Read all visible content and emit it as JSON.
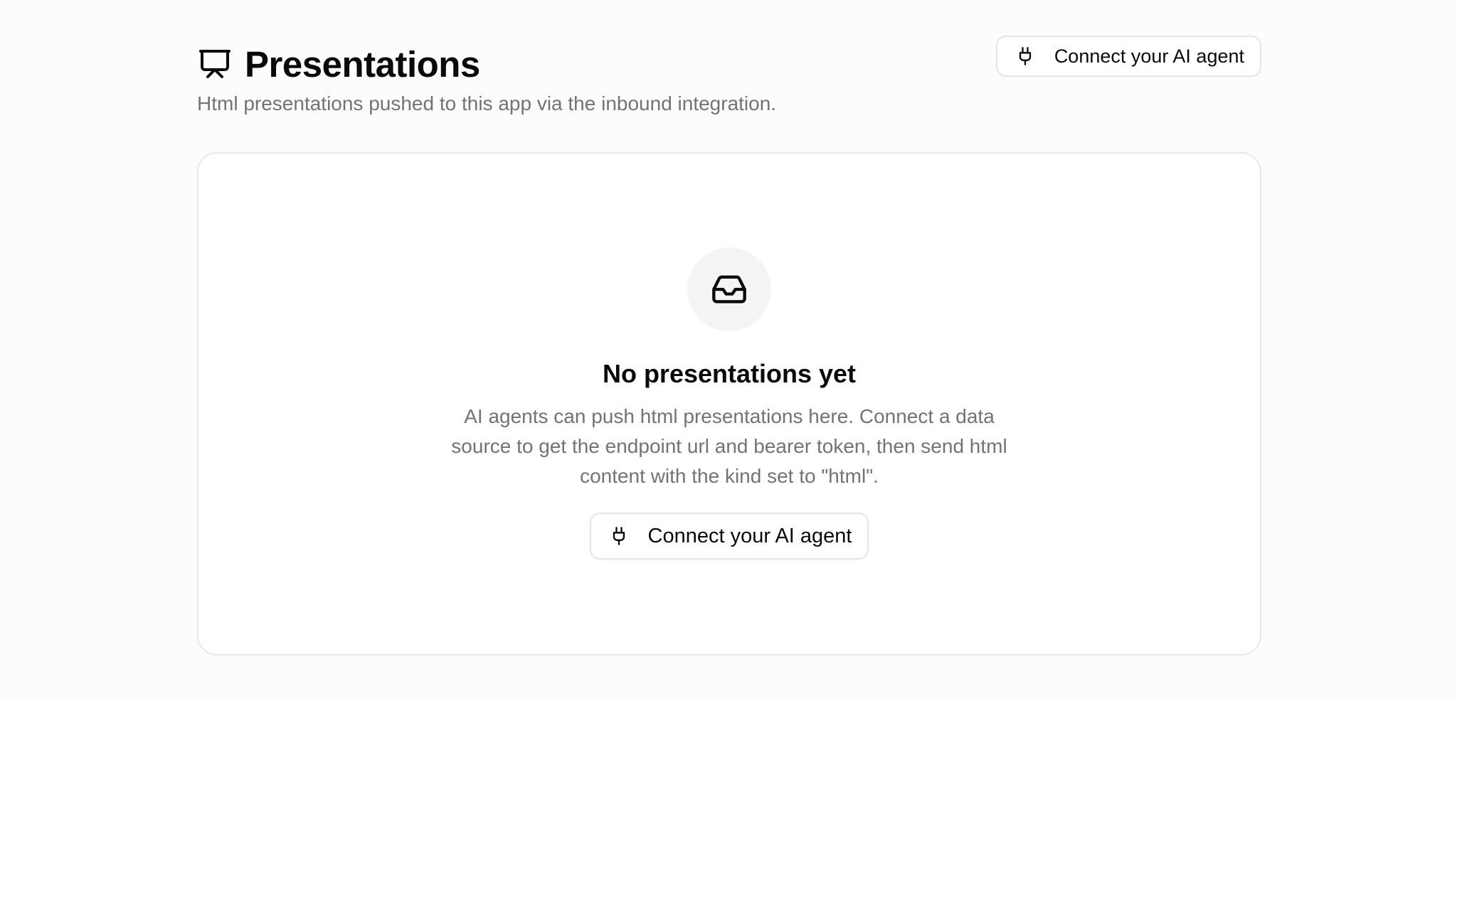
{
  "header": {
    "title": "Presentations",
    "subtitle": "Html presentations pushed to this app via the inbound integration.",
    "title_icon": "presentation-icon",
    "connect_button": {
      "label": "Connect your AI agent",
      "icon": "plug-icon"
    }
  },
  "empty_state": {
    "icon": "inbox-icon",
    "title": "No presentations yet",
    "description": "AI agents can push html presentations here. Connect a data source to get the endpoint url and bearer token, then send html content with the kind set to \"html\".",
    "connect_button": {
      "label": "Connect your AI agent",
      "icon": "plug-icon"
    }
  },
  "colors": {
    "text_primary": "#0a0a0a",
    "text_muted": "#737373",
    "border": "#e5e5e5",
    "page_background": "#fcfcfc",
    "card_background": "#ffffff",
    "icon_circle": "#f4f4f4"
  }
}
